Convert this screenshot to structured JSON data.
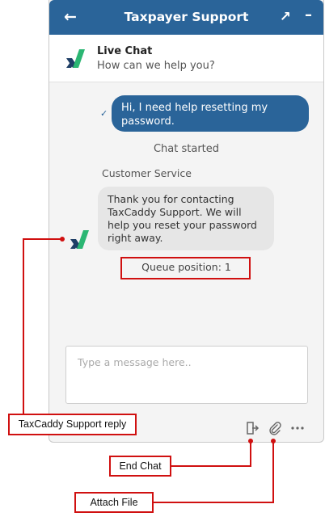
{
  "titlebar": {
    "title": "Taxpayer Support",
    "back_glyph": "←",
    "popout_glyph": "↗",
    "minimize_glyph": "–"
  },
  "live_header": {
    "title": "Live Chat",
    "subtitle": "How can we help you?"
  },
  "messages": {
    "user_message": "Hi, I need help resetting my password.",
    "delivered_glyph": "✓",
    "chat_started": "Chat started",
    "sender_label": "Customer Service",
    "agent_message": "Thank you for contacting TaxCaddy Support. We will help you reset your password right away.",
    "queue_position": "Queue position: 1"
  },
  "composer": {
    "placeholder": "Type a message here.."
  },
  "toolbar_icons": {
    "end_chat": "end-chat-icon",
    "attach": "paperclip-icon",
    "more": "more-icon",
    "more_glyph": "•••"
  },
  "callouts": {
    "reply": "TaxCaddy Support reply",
    "end_chat": "End Chat",
    "attach_file": "Attach File"
  },
  "colors": {
    "brand_blue": "#2a6499",
    "logo_green": "#2bb673",
    "logo_navy": "#1f3f66",
    "callout_red": "#d01010"
  }
}
